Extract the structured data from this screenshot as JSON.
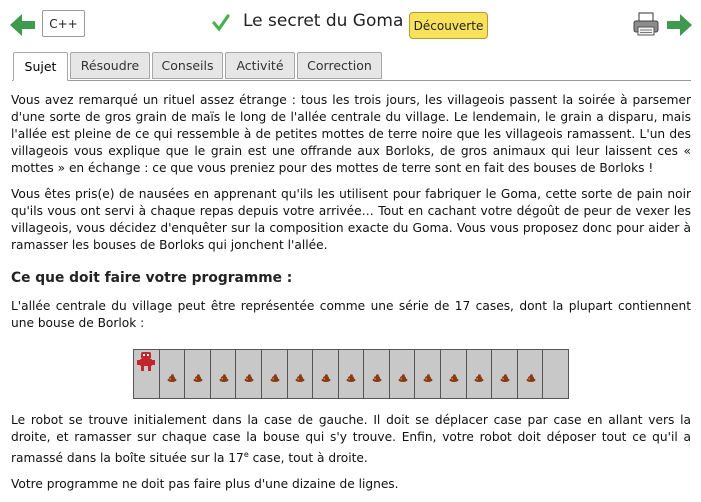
{
  "header": {
    "prev_label": "previous",
    "language": "C++",
    "title": "Le secret du Goma",
    "level_badge": "Découverte",
    "colors": {
      "arrow": "#3f9a4f",
      "check": "#49b04c",
      "badge_bg": "#f9e15b"
    }
  },
  "tabs": [
    {
      "label": "Sujet",
      "active": true
    },
    {
      "label": "Résoudre",
      "active": false
    },
    {
      "label": "Conseils",
      "active": false
    },
    {
      "label": "Activité",
      "active": false
    },
    {
      "label": "Correction",
      "active": false
    }
  ],
  "content": {
    "p1": "Vous avez remarqué un rituel assez étrange : tous les trois jours, les villageois passent la soirée à parsemer d'une sorte de gros grain de maïs le long de l'allée centrale du village. Le lendemain, le grain a disparu, mais l'allée est pleine de ce qui ressemble à de petites mottes de terre noire que les villageois ramassent. L'un des villageois vous explique que le grain est une offrande aux Borloks, de gros animaux qui leur laissent ces « mottes » en échange : ce que vous preniez pour des mottes de terre sont en fait des bouses de Borloks !",
    "p2": "Vous êtes pris(e) de nausées en apprenant qu'ils les utilisent pour fabriquer le Goma, cette sorte de pain noir qu'ils vous ont servi à chaque repas depuis votre arrivée… Tout en cachant votre dégoût de peur de vexer les villageois, vous décidez d'enquêter sur la composition exacte du Goma. Vous vous proposez donc pour aider à ramasser les bouses de Borloks qui jonchent l'allée.",
    "heading": "Ce que doit faire votre programme :",
    "p3": "L'allée centrale du village peut être représentée comme une série de 17 cases, dont la plupart contiennent une bouse de Borlok :",
    "p4_a": "Le robot se trouve initialement dans la case de gauche. Il doit se déplacer case par case en allant vers la droite, et ramasser sur chaque case la bouse qui s'y trouve. Enfin, votre robot doit déposer tout ce qu'il a ramassé dans la boîte située sur la 17",
    "p4_sup": "e",
    "p4_b": " case, tout à droite.",
    "p5": "Votre programme ne doit pas faire plus d'une dizaine de lignes."
  },
  "grid": {
    "cells": 17,
    "robot_cell": 0,
    "dung_cells": [
      1,
      2,
      3,
      4,
      5,
      6,
      7,
      8,
      9,
      10,
      11,
      12,
      13,
      14,
      15
    ],
    "cell_color": "#c8c8c8",
    "robot_color": "#c0262b",
    "dung_color": "#8a3a12"
  }
}
